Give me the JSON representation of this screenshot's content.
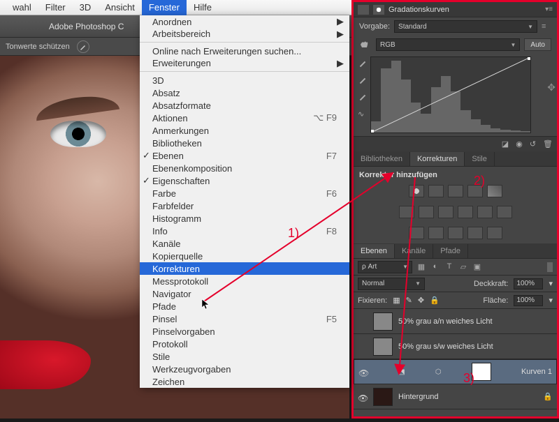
{
  "menubar": [
    "wahl",
    "Filter",
    "3D",
    "Ansicht",
    "Fenster",
    "Hilfe"
  ],
  "menubar_active": 4,
  "app_title": "Adobe Photoshop C",
  "option_bar": {
    "protect": "Tonwerte schützen"
  },
  "dropdown": [
    {
      "label": "Anordnen",
      "arrow": true
    },
    {
      "label": "Arbeitsbereich",
      "arrow": true,
      "sep": true
    },
    {
      "label": "Online nach Erweiterungen suchen..."
    },
    {
      "label": "Erweiterungen",
      "arrow": true,
      "sep": true
    },
    {
      "label": "3D"
    },
    {
      "label": "Absatz"
    },
    {
      "label": "Absatzformate"
    },
    {
      "label": "Aktionen",
      "shortcut": "⌥ F9"
    },
    {
      "label": "Anmerkungen"
    },
    {
      "label": "Bibliotheken"
    },
    {
      "label": "Ebenen",
      "check": true,
      "shortcut": "F7"
    },
    {
      "label": "Ebenenkomposition"
    },
    {
      "label": "Eigenschaften",
      "check": true
    },
    {
      "label": "Farbe",
      "shortcut": "F6"
    },
    {
      "label": "Farbfelder"
    },
    {
      "label": "Histogramm"
    },
    {
      "label": "Info",
      "shortcut": "F8"
    },
    {
      "label": "Kanäle"
    },
    {
      "label": "Kopierquelle"
    },
    {
      "label": "Korrekturen",
      "hi": true
    },
    {
      "label": "Messprotokoll"
    },
    {
      "label": "Navigator"
    },
    {
      "label": "Pfade"
    },
    {
      "label": "Pinsel",
      "shortcut": "F5"
    },
    {
      "label": "Pinselvorgaben"
    },
    {
      "label": "Protokoll"
    },
    {
      "label": "Stile"
    },
    {
      "label": "Werkzeugvorgaben"
    },
    {
      "label": "Zeichen"
    }
  ],
  "curves_panel": {
    "title": "Gradationskurven",
    "preset_label": "Vorgabe:",
    "preset_value": "Standard",
    "channel": "RGB",
    "auto": "Auto"
  },
  "adj_panel": {
    "tabs": [
      "Bibliotheken",
      "Korrekturen",
      "Stile"
    ],
    "hint": "Korrektur hinzufügen"
  },
  "layers_panel": {
    "tabs": [
      "Ebenen",
      "Kanäle",
      "Pfade"
    ],
    "filter_kind": "Art",
    "blend": "Normal",
    "opacity_label": "Deckkraft:",
    "opacity": "100%",
    "lock_label": "Fixieren:",
    "fill_label": "Fläche:",
    "fill": "100%",
    "layers": [
      {
        "name": "50% grau a/n weiches Licht"
      },
      {
        "name": "50% grau s/w weiches Licht"
      },
      {
        "name": "Kurven 1",
        "sel": true,
        "vis": true,
        "curves": true
      },
      {
        "name": "Hintergrund",
        "vis": true,
        "bg": true,
        "lock": true
      }
    ]
  },
  "annotations": {
    "n1": "1)",
    "n2": "2)",
    "n3": "3)"
  }
}
